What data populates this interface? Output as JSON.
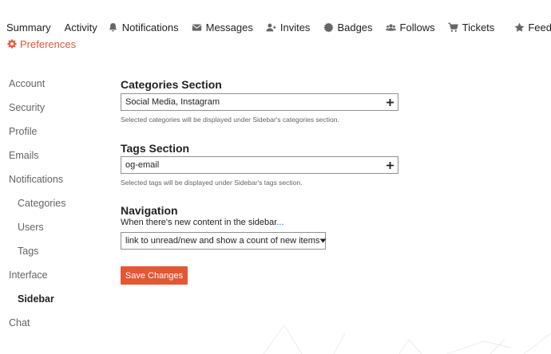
{
  "topnav": {
    "items": [
      {
        "label": "Summary",
        "icon": null
      },
      {
        "label": "Activity",
        "icon": null
      },
      {
        "label": "Notifications",
        "icon": "bell-icon"
      },
      {
        "label": "Messages",
        "icon": "envelope-icon"
      },
      {
        "label": "Invites",
        "icon": "user-plus-icon"
      },
      {
        "label": "Badges",
        "icon": "certificate-icon"
      },
      {
        "label": "Follows",
        "icon": "users-icon"
      },
      {
        "label": "Tickets",
        "icon": "cart-icon"
      },
      {
        "label": "Feedback",
        "icon": "star-icon"
      }
    ],
    "preferences": {
      "label": "Preferences",
      "icon": "gear-icon"
    }
  },
  "sidebar": {
    "items": [
      {
        "label": "Account"
      },
      {
        "label": "Security"
      },
      {
        "label": "Profile"
      },
      {
        "label": "Emails"
      },
      {
        "label": "Notifications"
      },
      {
        "label": "Categories"
      },
      {
        "label": "Users"
      },
      {
        "label": "Tags"
      },
      {
        "label": "Interface"
      },
      {
        "label": "Sidebar"
      },
      {
        "label": "Chat"
      }
    ],
    "active": "Sidebar"
  },
  "main": {
    "categories": {
      "title": "Categories Section",
      "value": "Social Media, Instagram",
      "hint": "Selected categories will be displayed under Sidebar's categories section."
    },
    "tags": {
      "title": "Tags Section",
      "value": "og-email",
      "hint": "Selected tags will be displayed under Sidebar's tags section."
    },
    "navigation": {
      "title": "Navigation",
      "description_prefix": "When there's new content in the sidebar",
      "description_suffix": "...",
      "selected": "link to unread/new and show a count of new items"
    },
    "save_label": "Save Changes"
  },
  "colors": {
    "accent": "#e45735",
    "text": "#222222",
    "muted": "#646464",
    "link": "#0a6cc7"
  }
}
